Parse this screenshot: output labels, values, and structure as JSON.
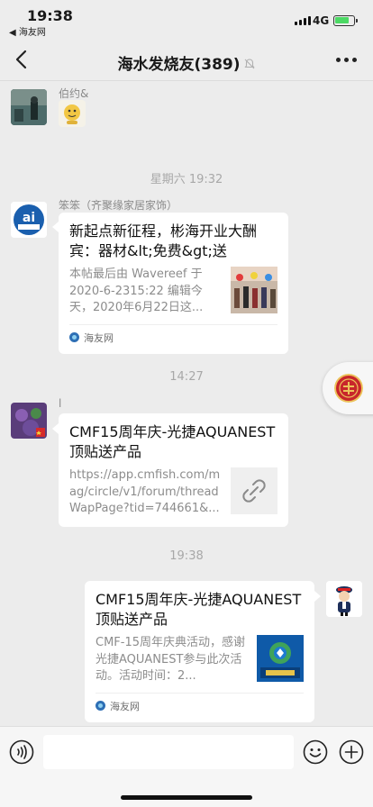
{
  "status_bar": {
    "time": "19:38",
    "back_app": "◀ 海友网",
    "network": "4G"
  },
  "nav": {
    "title": "海水发烧友(389)",
    "back_icon": "chevron-left-icon",
    "mute_icon": "bell-slash-icon",
    "more_icon": "ellipsis-icon"
  },
  "messages": [
    {
      "sender": "伯约&",
      "type": "sticker"
    },
    {
      "time_sep": "星期六 19:32"
    },
    {
      "sender": "笨笨（齐聚缘家居家饰）",
      "type": "link_card",
      "title": "新起点新征程，彬海开业大酬宾：器材&lt;免费&gt;送",
      "desc": "本帖最后由 Wavereef 于 2020-6-2315:22 编辑今天，2020年6月22日这...",
      "source": "海友网",
      "thumb": "group-photo"
    },
    {
      "time_sep": "14:27"
    },
    {
      "sender": "l",
      "type": "link_card",
      "title": "CMF15周年庆-光捷AQUANEST顶贴送产品",
      "desc": "https://app.cmfish.com/mag/circle/v1/forum/threadWapPage?tid=744661&...",
      "thumb": "link-icon"
    },
    {
      "time_sep": "19:38"
    },
    {
      "sender": "me",
      "type": "link_card",
      "title": "CMF15周年庆-光捷AQUANEST顶贴送产品",
      "desc": "CMF-15周年庆典活动，感谢光捷AQUANEST参与此次活动。活动时间：2...",
      "source": "海友网",
      "thumb": "aquanest-logo"
    }
  ],
  "float_badge_icon": "seal-icon",
  "input_bar": {
    "voice_icon": "voice-icon",
    "emoji_icon": "emoji-icon",
    "plus_icon": "plus-icon"
  },
  "colors": {
    "background": "#ececec",
    "bar": "#ededed",
    "card": "#ffffff",
    "muted_text": "#8c8c8c"
  }
}
